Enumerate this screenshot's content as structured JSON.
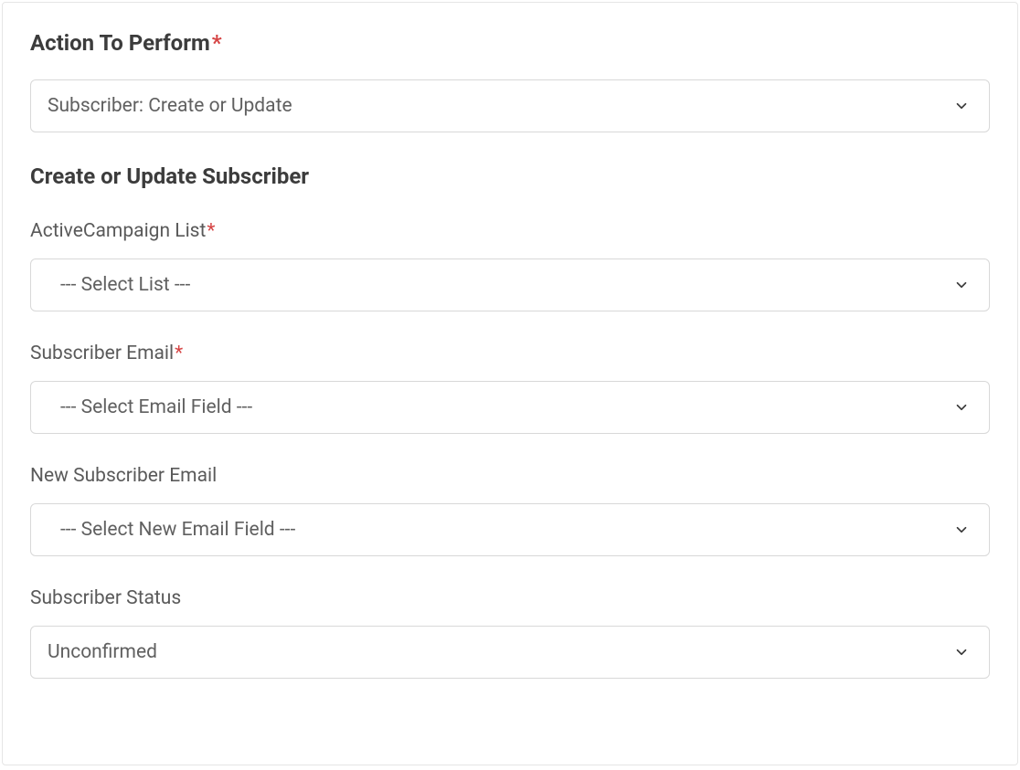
{
  "header": {
    "action_label": "Action To Perform",
    "action_value": "Subscriber: Create or Update"
  },
  "section_title": "Create or Update Subscriber",
  "fields": {
    "list": {
      "label": "ActiveCampaign List",
      "placeholder": "--- Select List ---"
    },
    "email": {
      "label": "Subscriber Email",
      "placeholder": "--- Select Email Field ---"
    },
    "new_email": {
      "label": "New Subscriber Email",
      "placeholder": "--- Select New Email Field ---"
    },
    "status": {
      "label": "Subscriber Status",
      "value": "Unconfirmed"
    }
  }
}
